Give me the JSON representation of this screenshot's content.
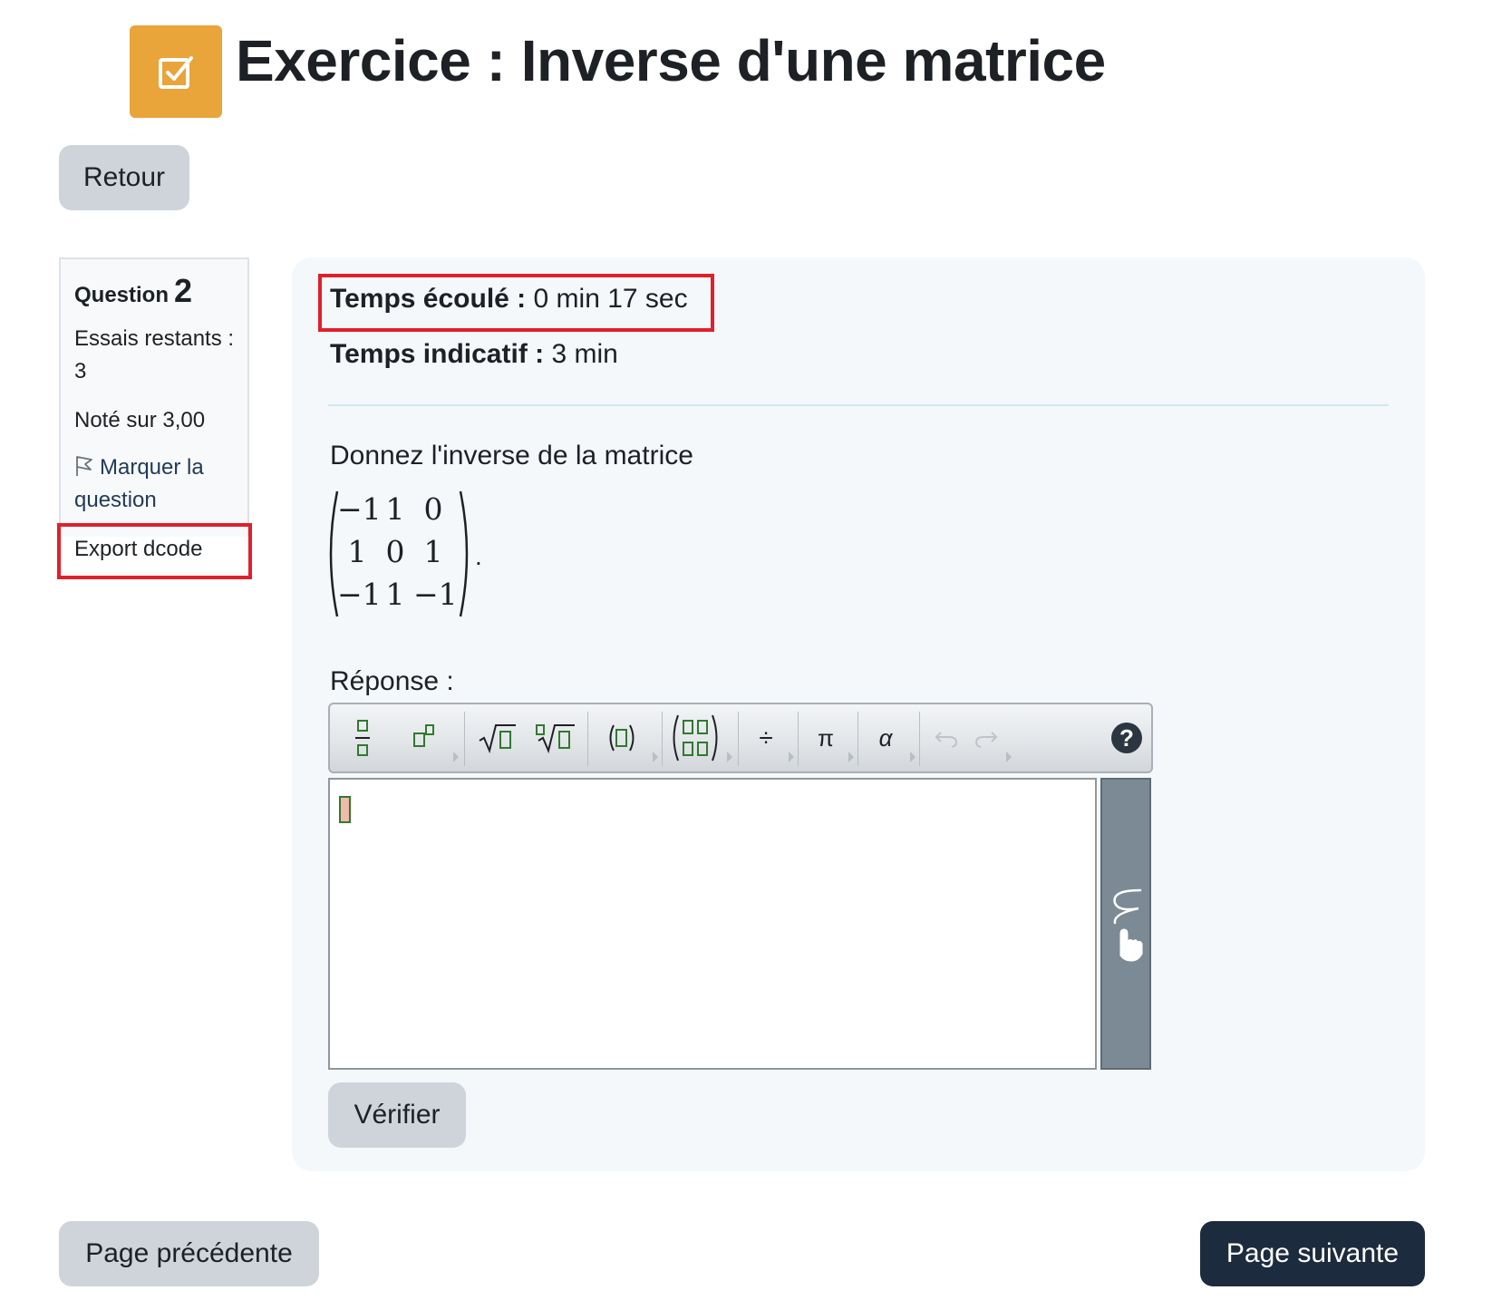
{
  "header": {
    "icon": "checkbox-icon",
    "title": "Exercice : Inverse d'une matrice",
    "accent_color": "#e9a43a"
  },
  "nav": {
    "back_label": "Retour",
    "prev_label": "Page précédente",
    "next_label": "Page suivante"
  },
  "question_info": {
    "question_word": "Question",
    "question_number": "2",
    "attempts": "Essais restants : 3",
    "marks": "Noté sur 3,00",
    "flag_label": "Marquer la question",
    "export_label": "Export dcode"
  },
  "timing": {
    "elapsed_label": "Temps écoulé :",
    "elapsed_value": "0 min 17 sec",
    "indicative_label": "Temps indicatif :",
    "indicative_value": "3 min"
  },
  "question": {
    "prompt": "Donnez l'inverse de la matrice",
    "matrix": [
      [
        "−1",
        "1",
        "0"
      ],
      [
        "1",
        "0",
        "1"
      ],
      [
        "−1",
        "1",
        "−1"
      ]
    ],
    "trailing": "."
  },
  "answer": {
    "label": "Réponse :",
    "toolbar": [
      "fraction-icon",
      "superscript-icon",
      "sqrt-icon",
      "nth-root-icon",
      "parentheses-icon",
      "matrix-icon",
      "divide-icon",
      "pi-icon",
      "alpha-icon",
      "undo-icon",
      "redo-icon",
      "help-icon"
    ],
    "divide_symbol": "÷",
    "pi_symbol": "π",
    "alpha_symbol": "α",
    "help_symbol": "?",
    "check_label": "Vérifier"
  },
  "colors": {
    "highlight_red": "#e0202a",
    "primary_dark": "#1d2b3e"
  }
}
